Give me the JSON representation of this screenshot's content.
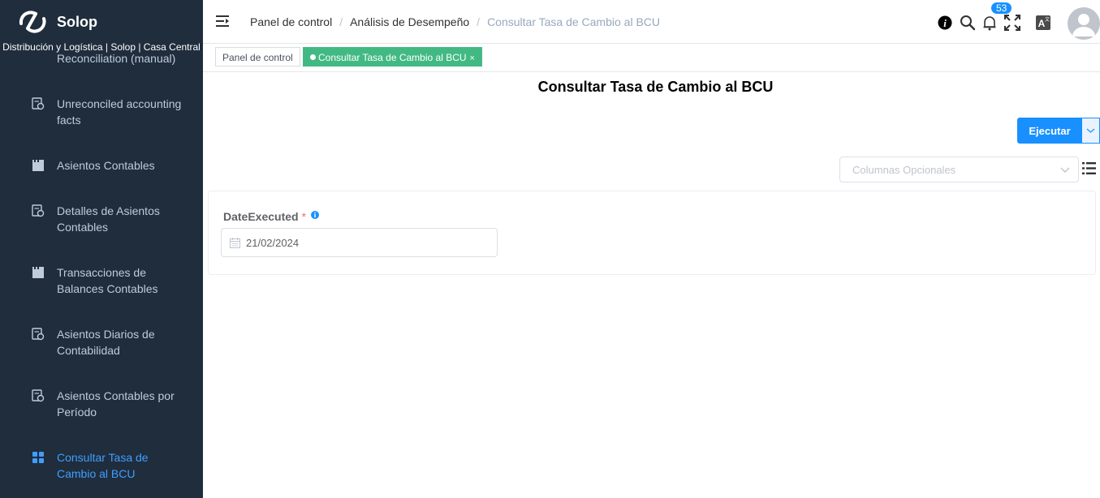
{
  "brand": {
    "name": "Solop",
    "org_line": "Distribución y Logística | Solop | Casa Central"
  },
  "sidebar": {
    "partial_item": "Reconciliation (manual)",
    "items": [
      {
        "label": "Unreconciled accounting facts",
        "icon": "report-icon"
      },
      {
        "label": "Asientos Contables",
        "icon": "window-icon"
      },
      {
        "label": "Detalles de Asientos Contables",
        "icon": "report-icon"
      },
      {
        "label": "Transacciones de Balances Contables",
        "icon": "window-icon"
      },
      {
        "label": "Asientos Diarios de Contabilidad",
        "icon": "report-icon"
      },
      {
        "label": "Asientos Contables por Período",
        "icon": "report-icon"
      },
      {
        "label": "Consultar Tasa de Cambio al BCU",
        "icon": "process-icon",
        "active": true
      }
    ]
  },
  "navbar": {
    "breadcrumb": [
      "Panel de control",
      "Análisis de Desempeño",
      "Consultar Tasa de Cambio al BCU"
    ],
    "notifications_count": "53",
    "icons": [
      "info-icon",
      "search-icon",
      "bell-icon",
      "fullscreen-icon",
      "translate-icon",
      "avatar"
    ]
  },
  "tags": [
    {
      "label": "Panel de control",
      "active": false
    },
    {
      "label": "Consultar Tasa de Cambio al BCU",
      "close": "×",
      "active": true
    }
  ],
  "page": {
    "title": "Consultar Tasa de Cambio al BCU",
    "run_button": "Ejecutar",
    "optional_columns_placeholder": "Columnas Opcionales"
  },
  "form": {
    "field_label": "DateExecuted",
    "required_mark": "*",
    "date_value": "21/02/2024"
  },
  "colors": {
    "sidebar_bg": "#1f2d3d",
    "accent": "#1890ff",
    "active_tag": "#42b983",
    "menu_active": "#409eff"
  }
}
